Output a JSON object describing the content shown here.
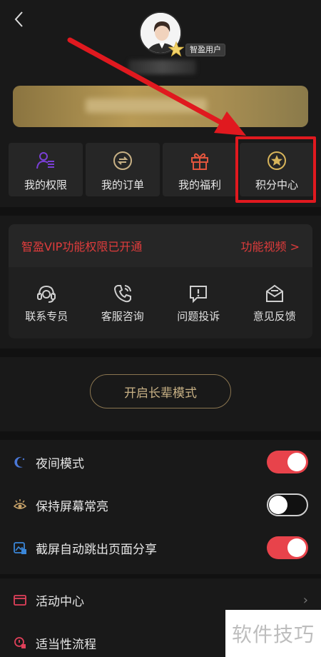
{
  "header": {
    "back_icon": "chevron-left-icon",
    "user_badge": "智盈用户"
  },
  "quick_actions": [
    {
      "label": "我的权限",
      "icon": "user-permission-icon",
      "color": "#7a3fd6"
    },
    {
      "label": "我的订单",
      "icon": "order-coin-icon",
      "color": "#c8b185"
    },
    {
      "label": "我的福利",
      "icon": "gift-icon",
      "color": "#e2553d"
    },
    {
      "label": "积分中心",
      "icon": "star-circle-icon",
      "color": "#d7b45a"
    }
  ],
  "vip_panel": {
    "status_text": "智盈VIP功能权限已开通",
    "video_link": "功能视频 >",
    "services": [
      {
        "label": "联系专员",
        "icon": "headset-icon"
      },
      {
        "label": "客服咨询",
        "icon": "phone-icon"
      },
      {
        "label": "问题投诉",
        "icon": "complaint-icon"
      },
      {
        "label": "意见反馈",
        "icon": "feedback-envelope-icon"
      }
    ]
  },
  "elder_mode_label": "开启长辈模式",
  "settings": [
    {
      "label": "夜间模式",
      "icon": "moon-icon",
      "toggle": true
    },
    {
      "label": "保持屏幕常亮",
      "icon": "eye-icon",
      "toggle": false
    },
    {
      "label": "截屏自动跳出页面分享",
      "icon": "screenshot-icon",
      "toggle": true
    }
  ],
  "menu": [
    {
      "label": "活动中心",
      "icon": "calendar-icon",
      "chevron": "›"
    },
    {
      "label": "适当性流程",
      "icon": "process-icon"
    }
  ],
  "watermark": "软件技巧",
  "colors": {
    "background": "#191919",
    "accent_red": "#e8434b",
    "gold": "#c8b185",
    "highlight": "#e0191f"
  }
}
